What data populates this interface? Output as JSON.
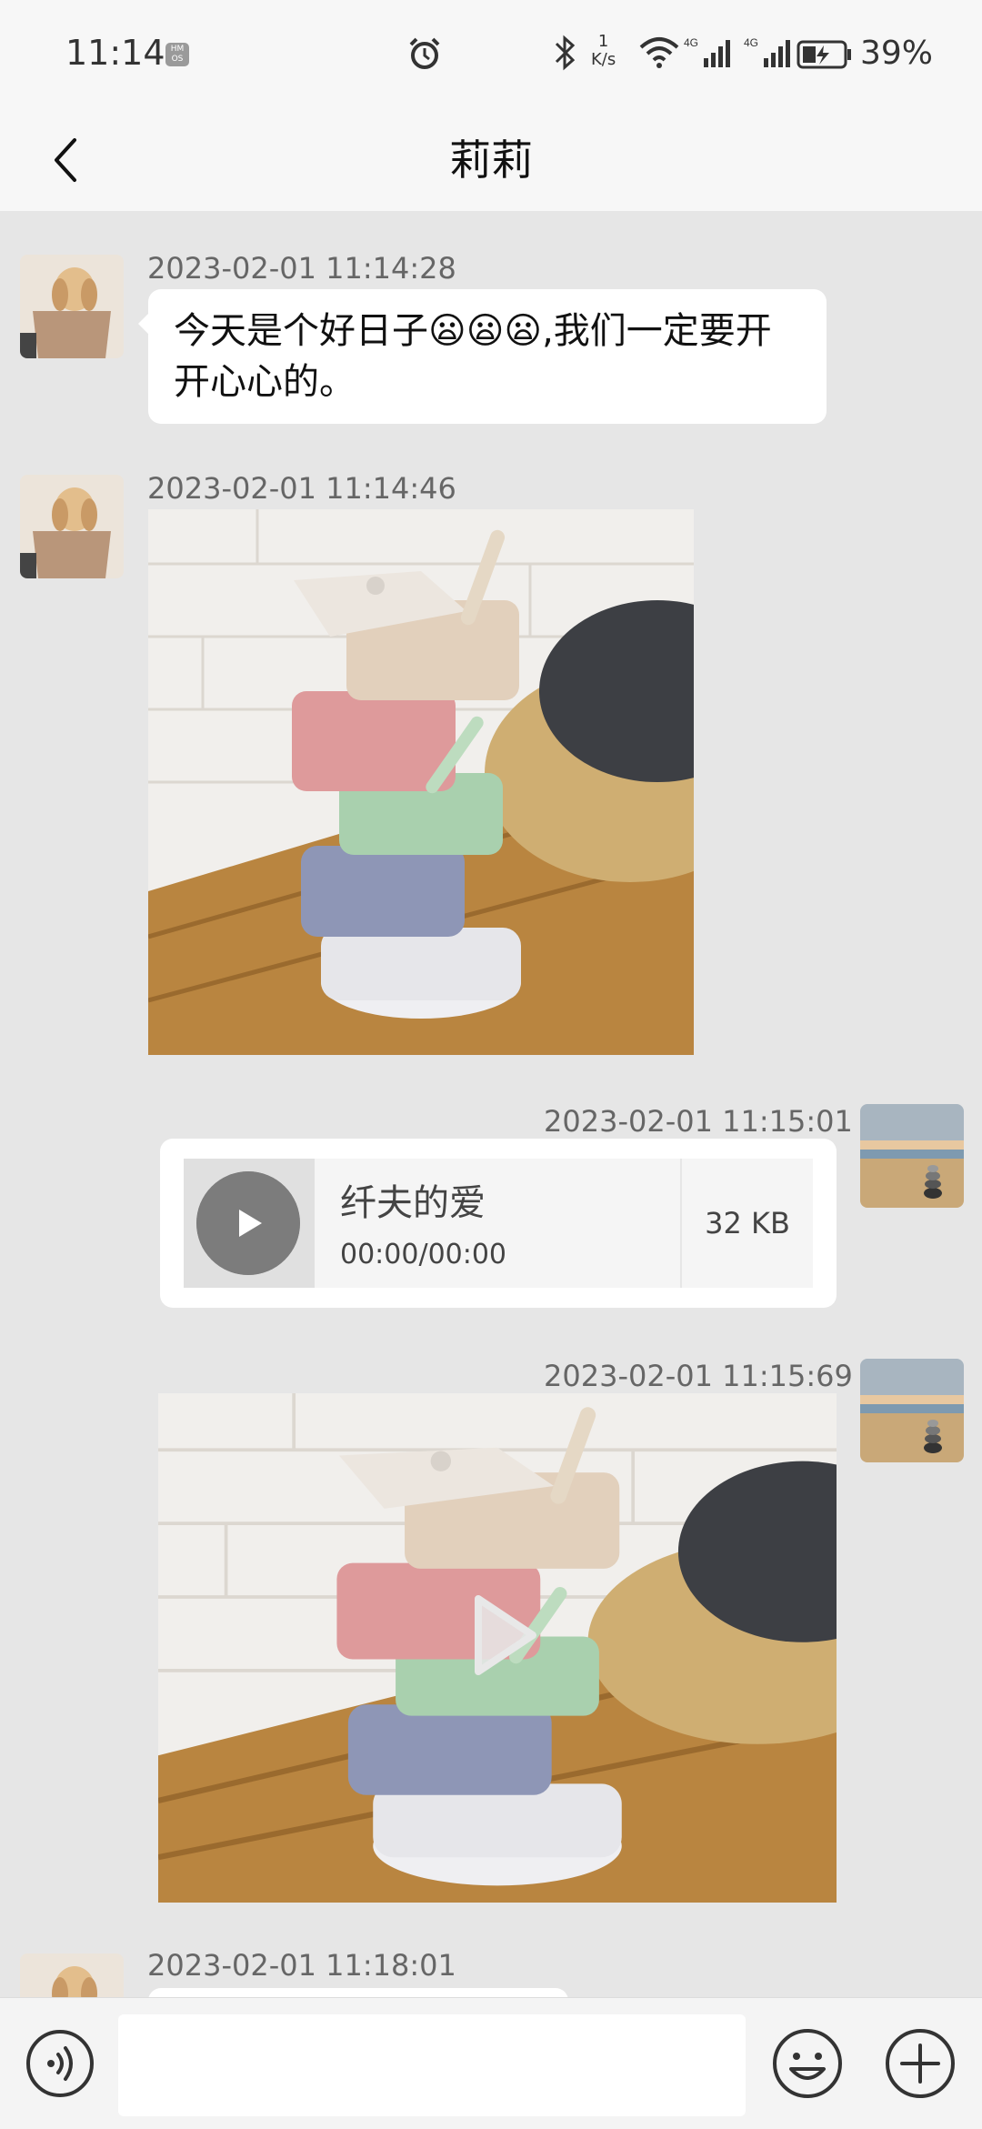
{
  "status_bar": {
    "time": "11:14",
    "os_badge": "HM OS",
    "net_speed_value": "1",
    "net_speed_unit": "K/s",
    "net_type": "4G",
    "battery": "39%"
  },
  "header": {
    "title": "莉莉"
  },
  "messages": [
    {
      "side": "left",
      "type": "text",
      "timestamp": "2023-02-01 11:14:28",
      "text": "今天是个好日子😦😦😦,我们一定要开开心心的。"
    },
    {
      "side": "left",
      "type": "image",
      "timestamp": "2023-02-01 11:14:46"
    },
    {
      "side": "right",
      "type": "audio",
      "timestamp": "2023-02-01 11:15:01",
      "title": "纤夫的爱",
      "duration": "00:00/00:00",
      "size": "32 KB"
    },
    {
      "side": "right",
      "type": "video",
      "timestamp": "2023-02-01 11:15:69"
    },
    {
      "side": "left",
      "type": "text",
      "timestamp": "2023-02-01 11:18:01"
    }
  ],
  "input": {
    "placeholder": ""
  },
  "icons": {
    "voice": "voice-wave-icon",
    "emoji": "smiley-icon",
    "more": "plus-icon",
    "back": "chevron-left-icon"
  }
}
